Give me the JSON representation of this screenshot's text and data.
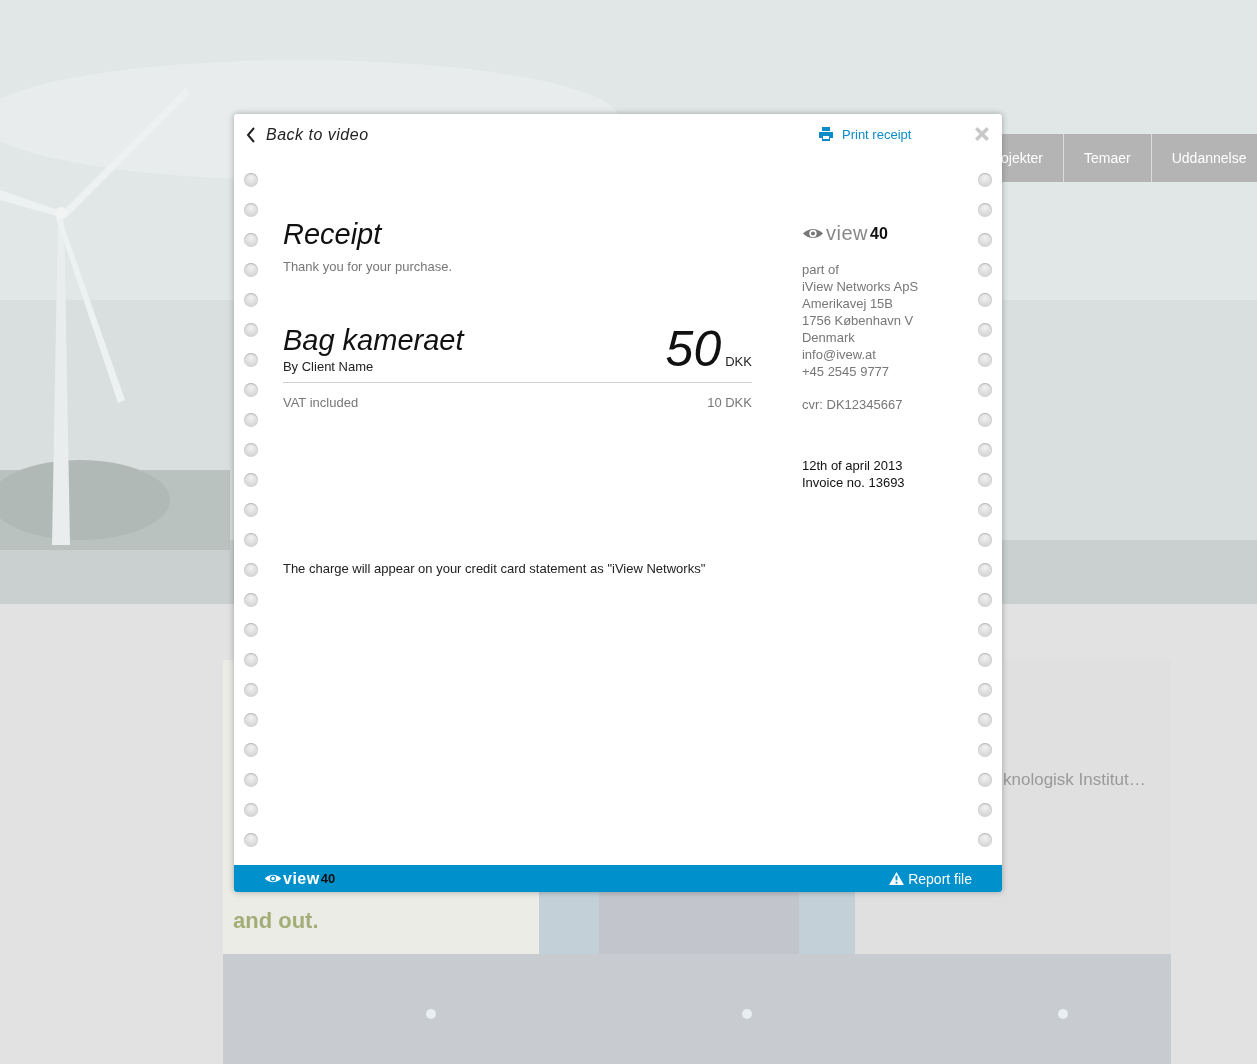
{
  "background": {
    "nav": [
      {
        "label": "ojekter"
      },
      {
        "label": "Temaer"
      },
      {
        "label": "Uddannelse"
      }
    ],
    "tiles": [
      {
        "kind": "text",
        "caption": "and out."
      },
      {
        "kind": "picture"
      },
      {
        "kind": "caption",
        "caption": "knologisk Institut…"
      },
      {
        "kind": "picture"
      },
      {
        "kind": "picture"
      },
      {
        "kind": "picture"
      }
    ]
  },
  "header": {
    "back": "Back to video",
    "print": "Print receipt"
  },
  "receipt": {
    "title": "Receipt",
    "thanks": "Thank you for your purchase.",
    "item": {
      "name": "Bag kameraet",
      "by": "By Client Name",
      "amount": "50",
      "currency": "DKK"
    },
    "vat": {
      "label": "VAT included",
      "value": "10 DKK"
    },
    "note": "The charge will appear on your credit card statement as \"iView Networks\""
  },
  "vendor": {
    "logo": {
      "word": "view",
      "number": "40"
    },
    "address": [
      "part of",
      "iView Networks ApS",
      "Amerikavej 15B",
      "1756 København V",
      "Denmark",
      "info@ivew.at",
      "+45 2545 9777"
    ],
    "cvr": "cvr: DK12345667",
    "date": "12th of april 2013",
    "invoice": "Invoice no. 13693"
  },
  "footer": {
    "logo": {
      "word": "view",
      "number": "40"
    },
    "report": "Report file"
  }
}
